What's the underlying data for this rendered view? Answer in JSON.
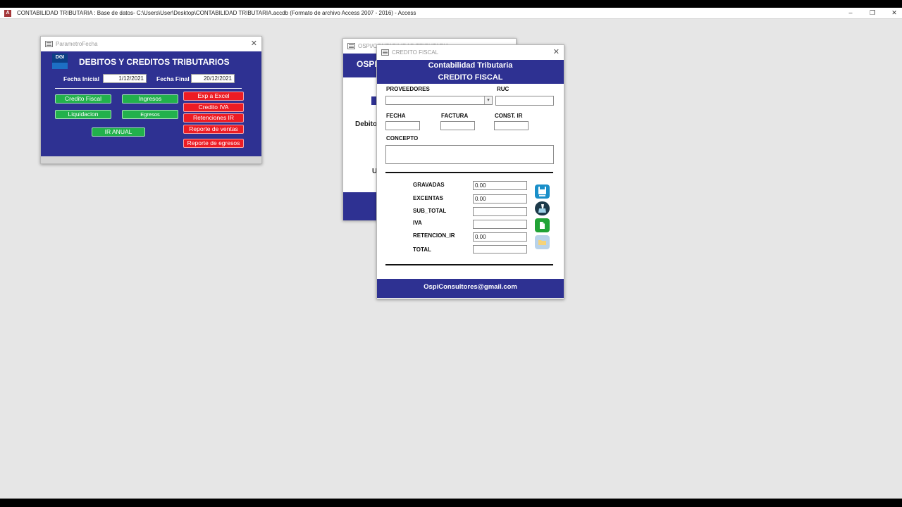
{
  "app": {
    "icon_letter": "A",
    "title": "CONTABILIDAD TRIBUTARIA : Base de datos- C:\\Users\\User\\Desktop\\CONTABILIDAD TRIBUTARIA.accdb (Formato de archivo Access 2007 - 2016) - Access",
    "controls": {
      "minimize": "–",
      "restore": "❐",
      "close": "✕"
    }
  },
  "param_window": {
    "title": "ParametroFecha",
    "close": "✕",
    "logo_text": "DGI",
    "heading": "DEBITOS Y CREDITOS TRIBUTARIOS",
    "fecha_inicial_label": "Fecha Inicial",
    "fecha_inicial_value": "1/12/2021",
    "fecha_final_label": "Fecha Final",
    "fecha_final_value": "20/12/2021",
    "buttons_green": {
      "credito_fiscal": "Credito Fiscal",
      "ingresos": "Ingresos",
      "liquidacion": "Liquidacion",
      "egresos": "Egresos",
      "ir_anual": "IR ANUAL"
    },
    "buttons_red": {
      "exp_excel": "Exp a Excel",
      "credito_iva": "Credito IVA",
      "retenciones_ir": "Retenciones IR",
      "reporte_ventas": "Reporte de ventas",
      "reporte_egresos": "Reporte de egresos"
    }
  },
  "back_window": {
    "title": "OSPI/CONTABILIDAD TRIBUTARIA",
    "header_partial": "OSPI,",
    "debito_partial": "Debito",
    "u_partial": "U"
  },
  "cf_window": {
    "title": "CREDITO FISCAL",
    "close": "✕",
    "header_line1": "Contabilidad Tributaria",
    "header_line2": "CREDITO FISCAL",
    "labels": {
      "proveedores": "PROVEEDORES",
      "ruc": "RUC",
      "fecha": "FECHA",
      "factura": "FACTURA",
      "const_ir": "CONST. IR",
      "concepto": "CONCEPTO",
      "gravadas": "GRAVADAS",
      "excentas": "EXCENTAS",
      "sub_total": "SUB_TOTAL",
      "iva": "IVA",
      "retencion_ir": "RETENCION_IR",
      "total": "TOTAL"
    },
    "values": {
      "proveedores": "",
      "ruc": "",
      "fecha": "",
      "factura": "",
      "const_ir": "",
      "concepto": "",
      "gravadas": "0.00",
      "excentas": "0.00",
      "sub_total": "",
      "iva": "",
      "retencion_ir": "0.00",
      "total": ""
    },
    "combo_arrow": "▾",
    "icons": {
      "save": "save-icon",
      "clean": "clean-icon",
      "excel": "excel-icon",
      "folder": "folder-icon"
    },
    "footer": "OspiConsultores@gmail.com"
  }
}
